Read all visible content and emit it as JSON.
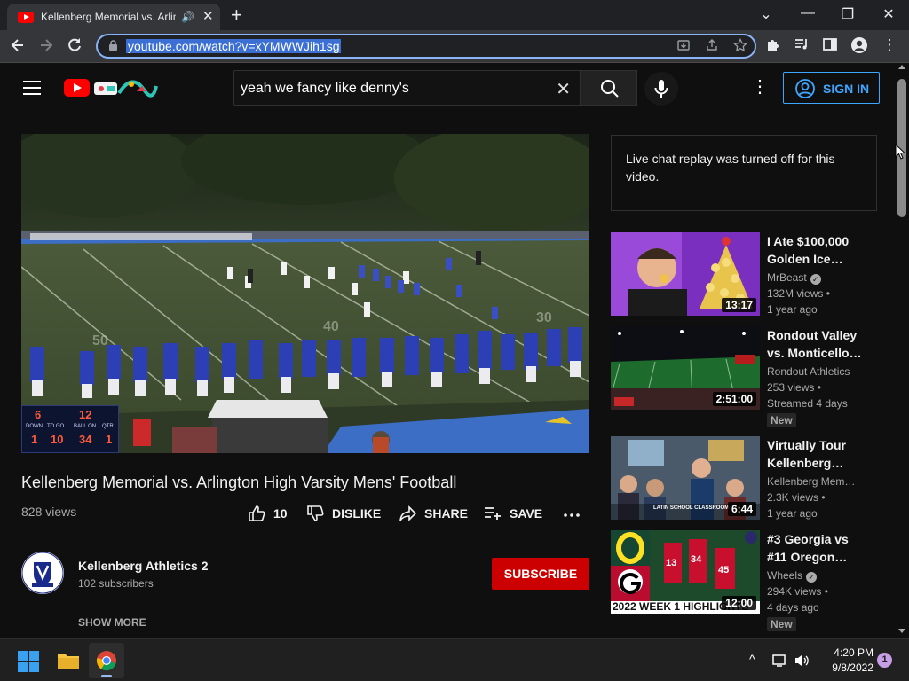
{
  "browser": {
    "tab_title": "Kellenberg Memorial vs. Arlington High",
    "new_tab": "+",
    "url": "youtube.com/watch?v=xYMWWJih1sg",
    "window_controls": [
      "⌄",
      "—",
      "❐",
      "✕"
    ]
  },
  "header": {
    "search_query": "yeah we fancy like denny's",
    "sign_in": "SIGN IN"
  },
  "video": {
    "title": "Kellenberg Memorial vs. Arlington High Varsity Mens' Football",
    "views": "828 views",
    "likes": "10",
    "dislike_label": "DISLIKE",
    "share_label": "SHARE",
    "save_label": "SAVE"
  },
  "scoreboard": {
    "home": "6",
    "visitor": "12",
    "down_label": "DOWN",
    "to_go_label": "TO GO",
    "ball_on_label": "BALL ON",
    "qtr_label": "QTR",
    "down": "1",
    "to_go": "10",
    "ball_on": "34",
    "qtr": "1"
  },
  "channel": {
    "name": "Kellenberg Athletics 2",
    "subscribers": "102 subscribers",
    "subscribe_label": "SUBSCRIBE",
    "show_more": "SHOW MORE"
  },
  "chat": {
    "message": "Live chat replay was turned off for this video."
  },
  "recommendations": [
    {
      "title": "I Ate $100,000 Golden Ice…",
      "channel": "MrBeast",
      "verified": true,
      "views": "132M views",
      "age": "1 year ago",
      "duration": "13:17",
      "badge": ""
    },
    {
      "title": "Rondout Valley vs. Monticello…",
      "channel": "Rondout Athletics",
      "verified": false,
      "views": "253 views",
      "age": "Streamed 4 days",
      "duration": "2:51:00",
      "badge": "New"
    },
    {
      "title": "Virtually Tour Kellenberg…",
      "channel": "Kellenberg Mem…",
      "verified": false,
      "views": "2.3K views",
      "age": "1 year ago",
      "duration": "6:44",
      "badge": "",
      "thumb_caption": "LATIN SCHOOL CLASSROOM"
    },
    {
      "title": "#3 Georgia vs #11 Oregon…",
      "channel": "Wheels",
      "verified": true,
      "views": "294K views",
      "age": "4 days ago",
      "duration": "12:00",
      "badge": "New",
      "thumb_caption": "2022 WEEK 1 HIGHLIGHTS"
    }
  ],
  "taskbar": {
    "time": "4:20 PM",
    "date": "9/8/2022",
    "notifications": "1"
  },
  "icons": {
    "check": "✓",
    "dot": "•",
    "more": "⋮",
    "clear": "✕",
    "close": "✕",
    "audio": "🔊",
    "lock": "🔒",
    "chevron_up": "^"
  },
  "colors": {
    "accent_blue": "#3ea6ff",
    "subscribe_red": "#cc0000",
    "youtube_red": "#ff0000",
    "background": "#0f0f0f"
  }
}
